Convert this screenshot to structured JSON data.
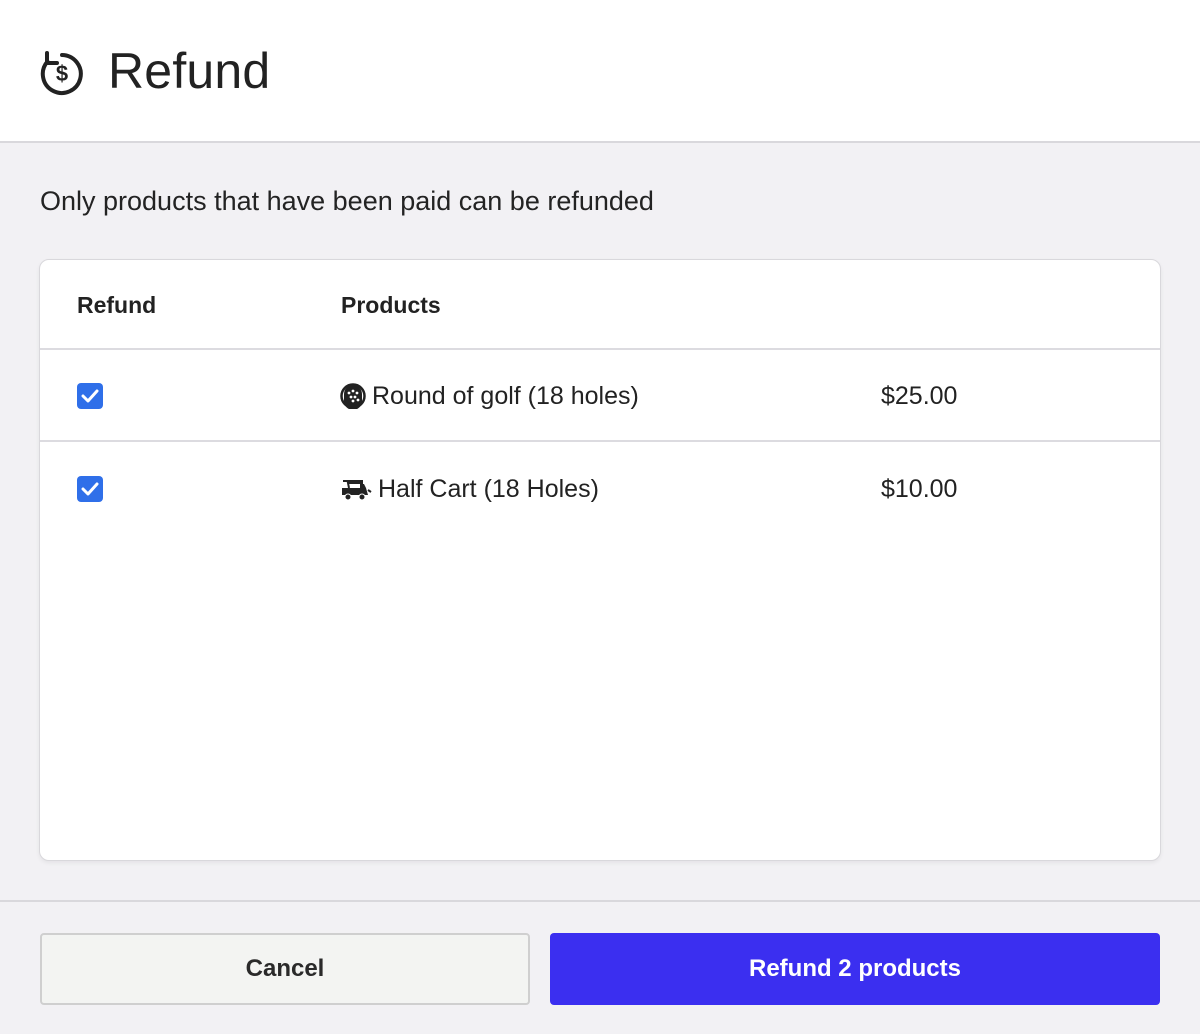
{
  "header": {
    "title": "Refund",
    "icon": "refund-dollar-icon"
  },
  "notice": "Only products that have been paid can be refunded",
  "table": {
    "columns": [
      "Refund",
      "Products"
    ],
    "rows": [
      {
        "checked": true,
        "icon": "golf-ball-icon",
        "product": "Round of golf (18 holes)",
        "price": "$25.00"
      },
      {
        "checked": true,
        "icon": "golf-cart-icon",
        "product": "Half Cart (18 Holes)",
        "price": "$10.00"
      }
    ]
  },
  "footer": {
    "cancel_label": "Cancel",
    "refund_label": "Refund 2 products"
  },
  "colors": {
    "primary": "#3b2ff0",
    "checkbox": "#2f6fe9",
    "background": "#f2f1f4"
  }
}
